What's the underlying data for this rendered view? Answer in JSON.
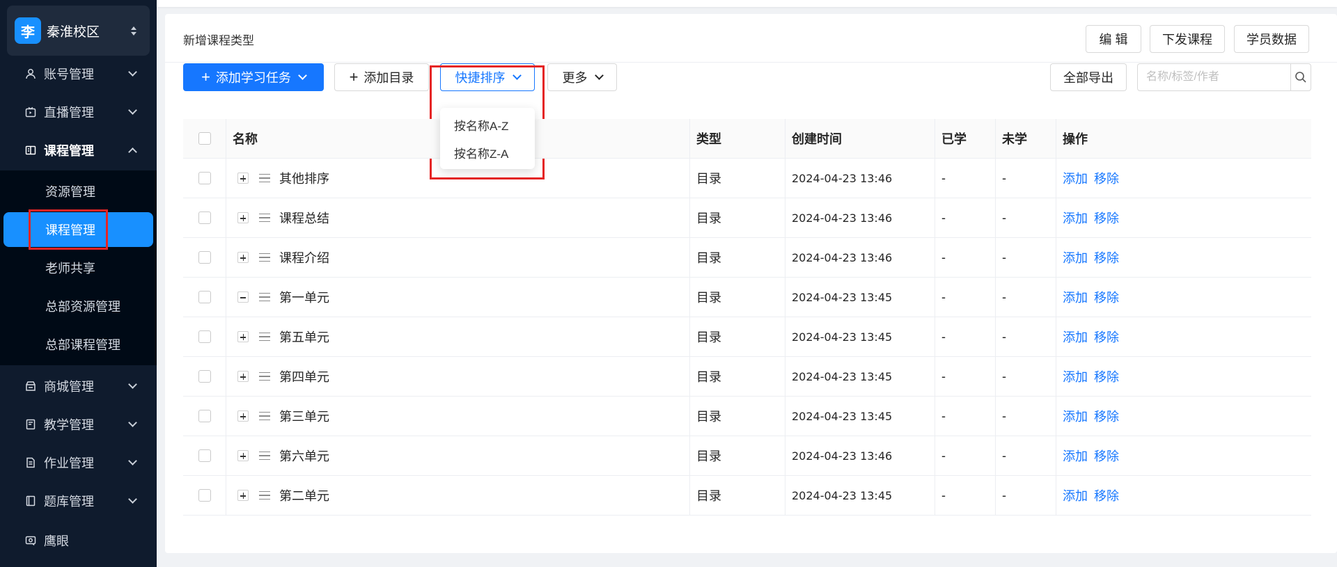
{
  "sidebar": {
    "campus": {
      "avatar": "李",
      "name": "秦淮校区"
    },
    "menus": {
      "account": "账号管理",
      "live": "直播管理",
      "course": "课程管理",
      "mall": "商城管理",
      "teaching": "教学管理",
      "homework": "作业管理",
      "question": "题库管理",
      "eagle": "鹰眼"
    },
    "sub": {
      "resource": "资源管理",
      "course": "课程管理",
      "teacher_share": "老师共享",
      "hq_resource": "总部资源管理",
      "hq_course": "总部课程管理"
    }
  },
  "header": {
    "title": "新增课程类型",
    "edit": "编 辑",
    "distribute": "下发课程",
    "student_data": "学员数据"
  },
  "toolbar": {
    "add_task": "添加学习任务",
    "add_dir": "添加目录",
    "quick_sort": "快捷排序",
    "more": "更多",
    "export_all": "全部导出",
    "search_placeholder": "名称/标签/作者"
  },
  "sort_menu": [
    "按名称A-Z",
    "按名称Z-A"
  ],
  "table": {
    "headers": {
      "name": "名称",
      "type": "类型",
      "created": "创建时间",
      "learned": "已学",
      "unlearned": "未学",
      "ops": "操作"
    },
    "op_add": "添加",
    "op_remove": "移除",
    "rows": [
      {
        "name": "其他排序",
        "type": "目录",
        "created": "2024-04-23 13:46",
        "learned": "-",
        "unlearned": "-",
        "expanded": false
      },
      {
        "name": "课程总结",
        "type": "目录",
        "created": "2024-04-23 13:46",
        "learned": "-",
        "unlearned": "-",
        "expanded": false
      },
      {
        "name": "课程介绍",
        "type": "目录",
        "created": "2024-04-23 13:46",
        "learned": "-",
        "unlearned": "-",
        "expanded": false
      },
      {
        "name": "第一单元",
        "type": "目录",
        "created": "2024-04-23 13:45",
        "learned": "-",
        "unlearned": "-",
        "expanded": true
      },
      {
        "name": "第五单元",
        "type": "目录",
        "created": "2024-04-23 13:45",
        "learned": "-",
        "unlearned": "-",
        "expanded": false
      },
      {
        "name": "第四单元",
        "type": "目录",
        "created": "2024-04-23 13:45",
        "learned": "-",
        "unlearned": "-",
        "expanded": false
      },
      {
        "name": "第三单元",
        "type": "目录",
        "created": "2024-04-23 13:45",
        "learned": "-",
        "unlearned": "-",
        "expanded": false
      },
      {
        "name": "第六单元",
        "type": "目录",
        "created": "2024-04-23 13:46",
        "learned": "-",
        "unlearned": "-",
        "expanded": false
      },
      {
        "name": "第二单元",
        "type": "目录",
        "created": "2024-04-23 13:45",
        "learned": "-",
        "unlearned": "-",
        "expanded": false
      }
    ]
  },
  "colors": {
    "primary": "#1677ff",
    "sidebar_bg": "#0f1b2d",
    "highlight": "#e52424"
  }
}
